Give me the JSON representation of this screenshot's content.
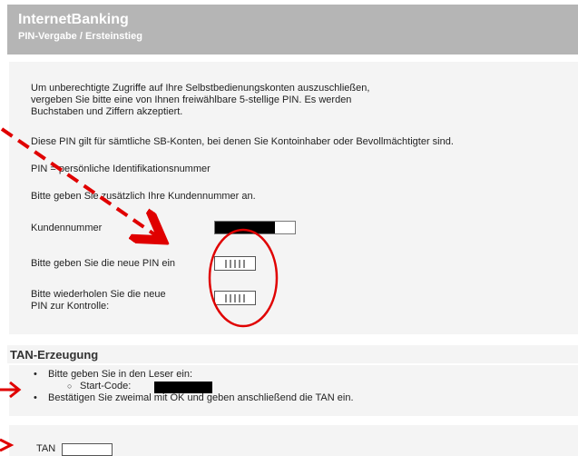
{
  "header": {
    "title": "InternetBanking",
    "subtitle": "PIN-Vergabe / Ersteinstieg"
  },
  "intro": {
    "line1": "Um unberechtigte Zugriffe auf Ihre Selbstbedienungskonten auszuschließen,",
    "line2": "vergeben Sie bitte eine von Ihnen freiwählbare 5-stellige PIN. Es werden",
    "line3": "Buchstaben und Ziffern akzeptiert.",
    "sb_note": "Diese PIN gilt für sämtliche SB-Konten, bei denen Sie Kontoinhaber oder Bevollmächtigter sind.",
    "pin_def": "PIN = persönliche Identifikationsnummer",
    "kunden_hint": "Bitte geben Sie zusätzlich Ihre Kundennummer an."
  },
  "form": {
    "kundennummer_label": "Kundennummer",
    "new_pin_label": "Bitte geben Sie die neue PIN ein",
    "repeat_pin_label_1": "Bitte wiederholen Sie die neue",
    "repeat_pin_label_2": "PIN zur Kontrolle:"
  },
  "tan": {
    "heading": "TAN-Erzeugung",
    "bullet1": "Bitte geben Sie in den Leser ein:",
    "subbullet": "Start-Code:",
    "bullet2": "Bestätigen Sie zweimal mit OK und geben anschließend die TAN ein.",
    "tan_label": "TAN"
  },
  "colors": {
    "header_bg": "#b5b5b5",
    "panel_bg": "#f4f4f4",
    "annotation_red": "#e00000"
  }
}
